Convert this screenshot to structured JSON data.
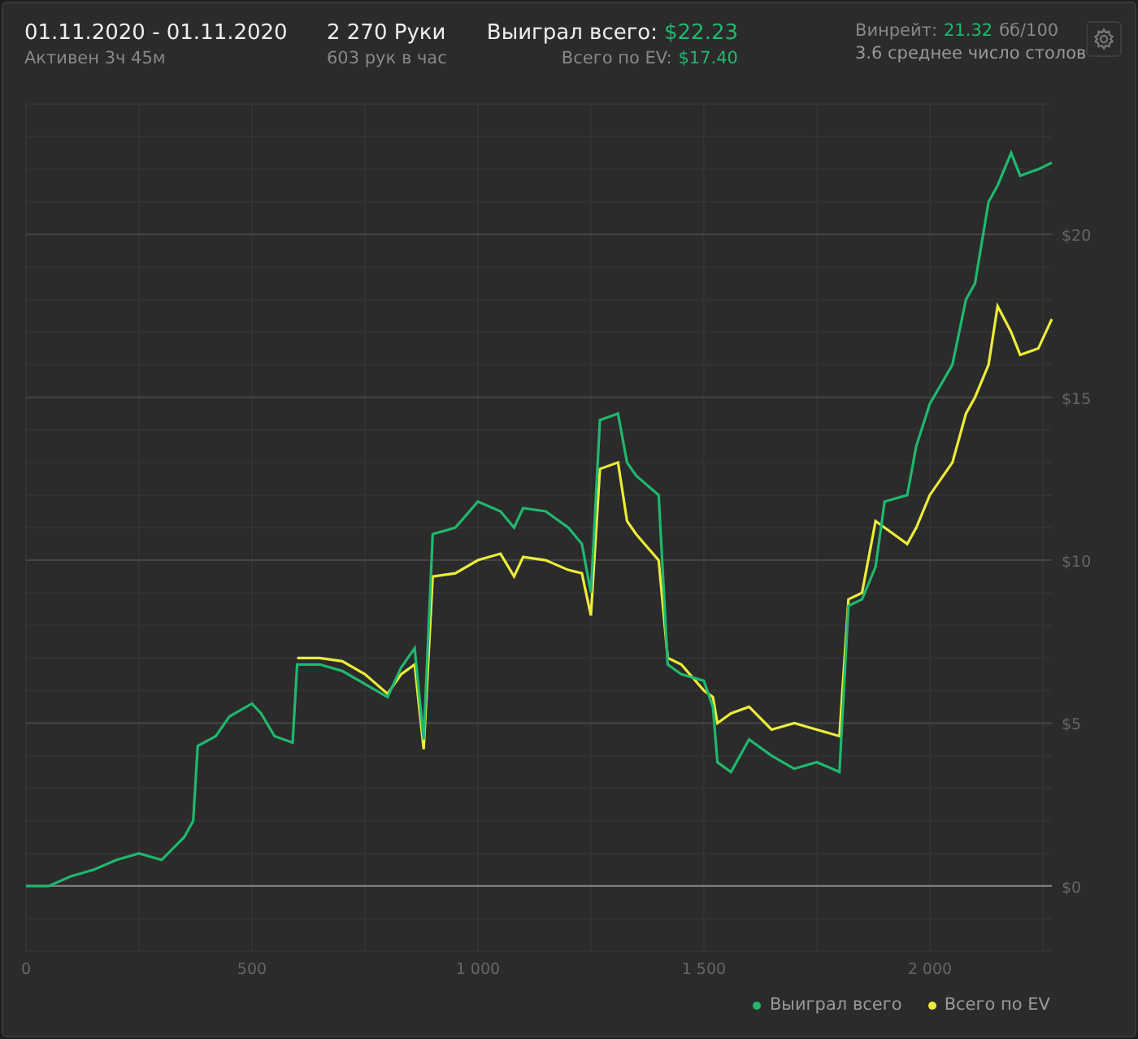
{
  "header": {
    "date_range": "01.11.2020 - 01.11.2020",
    "active_time": "Активен 3ч 45м",
    "hands": "2 270 Руки",
    "hands_per_hour": "603 рук в час",
    "won_label": "Выиграл всего:",
    "won_value": "$22.23",
    "ev_label": "Всего по EV:",
    "ev_value": "$17.40",
    "winrate_label": "Винрейт:",
    "winrate_value": "21.32",
    "winrate_unit": "бб/100",
    "tables": "3.6 среднее число столов"
  },
  "chart": {
    "chart_data": {
      "type": "line",
      "x": [
        0,
        50,
        100,
        150,
        200,
        250,
        300,
        350,
        370,
        380,
        420,
        450,
        500,
        520,
        550,
        590,
        600,
        650,
        700,
        750,
        800,
        830,
        860,
        880,
        900,
        950,
        1000,
        1050,
        1080,
        1100,
        1150,
        1200,
        1230,
        1250,
        1270,
        1310,
        1330,
        1350,
        1400,
        1420,
        1450,
        1500,
        1520,
        1530,
        1560,
        1600,
        1650,
        1700,
        1750,
        1800,
        1820,
        1850,
        1880,
        1900,
        1950,
        1970,
        2000,
        2050,
        2080,
        2100,
        2130,
        2150,
        2180,
        2200,
        2240,
        2270
      ],
      "series": [
        {
          "name": "Выиграл всего",
          "color": "#1fb86e",
          "values": [
            0,
            0,
            0.3,
            0.5,
            0.8,
            1.0,
            0.8,
            1.5,
            2.0,
            4.3,
            4.6,
            5.2,
            5.6,
            5.3,
            4.6,
            4.4,
            6.8,
            6.8,
            6.6,
            6.2,
            5.8,
            6.7,
            7.3,
            4.5,
            10.8,
            11.0,
            11.8,
            11.5,
            11.0,
            11.6,
            11.5,
            11.0,
            10.5,
            9.0,
            14.3,
            14.5,
            13.0,
            12.6,
            12.0,
            6.8,
            6.5,
            6.3,
            5.5,
            3.8,
            3.5,
            4.5,
            4.0,
            3.6,
            3.8,
            3.5,
            8.6,
            8.8,
            9.8,
            11.8,
            12.0,
            13.5,
            14.8,
            16.0,
            18.0,
            18.5,
            21.0,
            21.5,
            22.5,
            21.8,
            22.0,
            22.2
          ]
        },
        {
          "name": "Всего по EV",
          "color": "#ecec3a",
          "values": [
            null,
            null,
            null,
            null,
            null,
            null,
            null,
            null,
            null,
            null,
            null,
            null,
            null,
            null,
            null,
            null,
            7.0,
            7.0,
            6.9,
            6.5,
            5.9,
            6.5,
            6.8,
            4.2,
            9.5,
            9.6,
            10.0,
            10.2,
            9.5,
            10.1,
            10.0,
            9.7,
            9.6,
            8.3,
            12.8,
            13.0,
            11.2,
            10.8,
            10.0,
            7.0,
            6.8,
            6.0,
            5.8,
            5.0,
            5.3,
            5.5,
            4.8,
            5.0,
            4.8,
            4.6,
            8.8,
            9.0,
            11.2,
            11.0,
            10.5,
            11.0,
            12.0,
            13.0,
            14.5,
            15.0,
            16.0,
            17.8,
            17.0,
            16.3,
            16.5,
            17.4
          ]
        }
      ],
      "grid": true,
      "xlim": [
        0,
        2270
      ],
      "ylim": [
        -2,
        24
      ],
      "xticks": [
        {
          "value": 0,
          "label": "0"
        },
        {
          "value": 500,
          "label": "500"
        },
        {
          "value": 1000,
          "label": "1 000"
        },
        {
          "value": 1500,
          "label": "1 500"
        },
        {
          "value": 2000,
          "label": "2 000"
        }
      ],
      "yticks": [
        {
          "value": 0,
          "label": "$0"
        },
        {
          "value": 5,
          "label": "$5"
        },
        {
          "value": 10,
          "label": "$10"
        },
        {
          "value": 15,
          "label": "$15"
        },
        {
          "value": 20,
          "label": "$20"
        }
      ]
    }
  }
}
